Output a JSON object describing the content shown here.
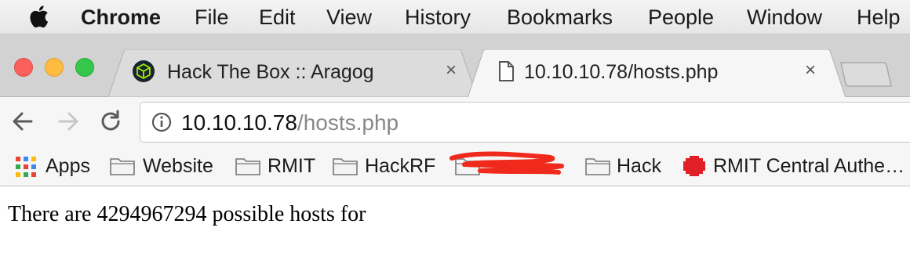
{
  "menubar": {
    "items": [
      "Chrome",
      "File",
      "Edit",
      "View",
      "History",
      "Bookmarks",
      "People",
      "Window",
      "Help"
    ]
  },
  "tabs": [
    {
      "title": "Hack The Box :: Aragog",
      "active": false,
      "favicon": "hackthebox-cube-icon",
      "close": "×"
    },
    {
      "title": "10.10.10.78/hosts.php",
      "active": true,
      "favicon": "page-icon",
      "close": "×"
    }
  ],
  "window_controls": {
    "close_color": "#fc605c",
    "minimize_color": "#fdbc40",
    "zoom_color": "#34c84a"
  },
  "omnibox": {
    "host": "10.10.10.78",
    "path": "/hosts.php"
  },
  "bookmarks": [
    {
      "label": "Apps",
      "icon": "apps-grid-icon"
    },
    {
      "label": "Website",
      "icon": "folder-icon"
    },
    {
      "label": "RMIT",
      "icon": "folder-icon"
    },
    {
      "label": "HackRF",
      "icon": "folder-icon"
    },
    {
      "label": "",
      "icon": "folder-icon"
    },
    {
      "label": "Hack",
      "icon": "folder-icon"
    },
    {
      "label": "RMIT Central Authe…",
      "icon": "rmit-pixel-icon"
    }
  ],
  "content": {
    "text": "There are 4294967294 possible hosts for"
  }
}
